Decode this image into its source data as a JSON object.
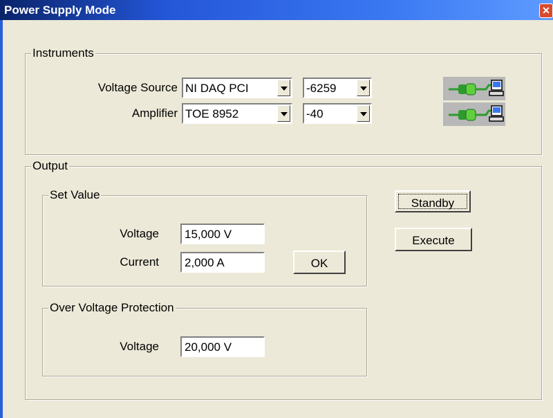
{
  "window": {
    "title": "Power Supply Mode",
    "close_label": "x"
  },
  "instruments": {
    "title": "Instruments",
    "rows": [
      {
        "label": "Voltage Source",
        "device": "NI DAQ PCI",
        "model": "-6259",
        "connection_icon": "plug-computer-icon"
      },
      {
        "label": "Amplifier",
        "device": "TOE 8952",
        "model": "-40",
        "connection_icon": "plug-computer-icon"
      }
    ]
  },
  "output": {
    "title": "Output",
    "set_value": {
      "title": "Set Value",
      "voltage_label": "Voltage",
      "voltage_value": "15,000 V",
      "current_label": "Current",
      "current_value": "2,000 A",
      "ok_label": "OK"
    },
    "ovp": {
      "title": "Over Voltage Protection",
      "voltage_label": "Voltage",
      "voltage_value": "20,000 V"
    },
    "standby_label": "Standby",
    "execute_label": "Execute"
  },
  "colors": {
    "titlebar": "#2456d8",
    "face": "#ece9d8",
    "plug": "#2e9a2e"
  }
}
